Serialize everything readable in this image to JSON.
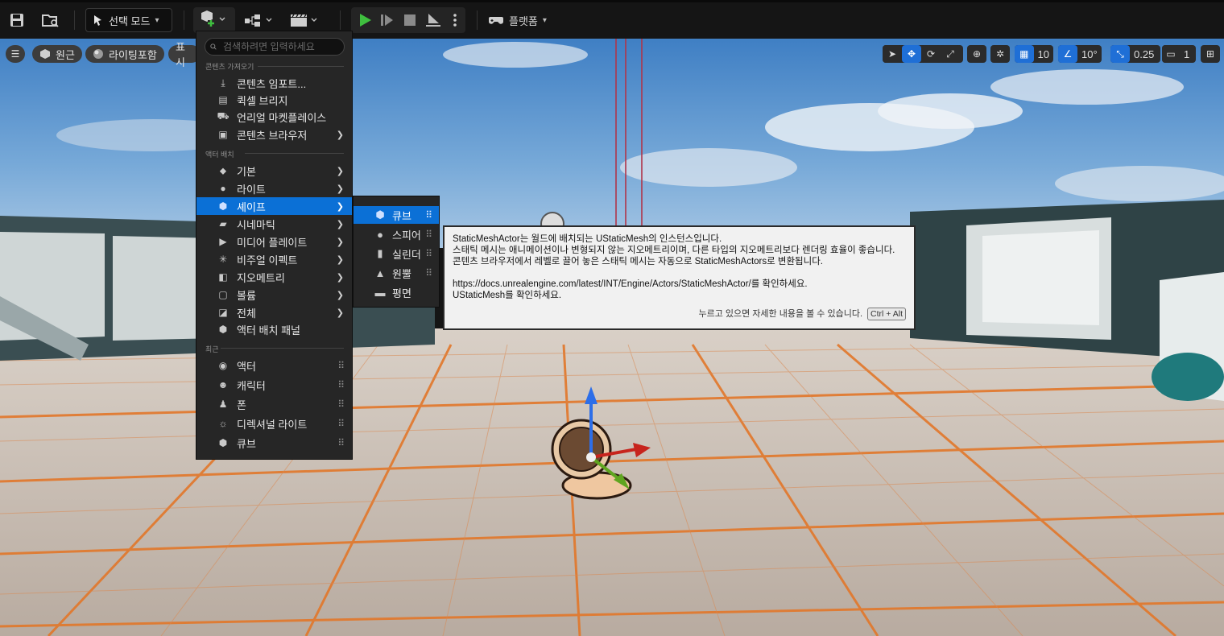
{
  "toolbar": {
    "mode_label": "선택 모드",
    "platform_label": "플랫폼"
  },
  "viewport": {
    "view_label": "원근",
    "lighting_label": "라이팅포함",
    "show_label": "표시",
    "grid_snap_value": "10",
    "rotation_snap_value": "10°",
    "scale_snap_value": "0.25",
    "camera_speed_value": "1"
  },
  "menu": {
    "search_placeholder": "검색하려면 입력하세요",
    "sections": {
      "import": "콘텐츠 가져오기",
      "placement": "액터 배치",
      "recent": "최근"
    },
    "import_items": [
      {
        "label": "콘텐츠 임포트..."
      },
      {
        "label": "퀵셀 브리지"
      },
      {
        "label": "언리얼 마켓플레이스"
      },
      {
        "label": "콘텐츠 브라우저"
      }
    ],
    "placement_items": [
      {
        "label": "기본"
      },
      {
        "label": "라이트"
      },
      {
        "label": "셰이프"
      },
      {
        "label": "시네마틱"
      },
      {
        "label": "미디어 플레이트"
      },
      {
        "label": "비주얼 이펙트"
      },
      {
        "label": "지오메트리"
      },
      {
        "label": "볼륨"
      },
      {
        "label": "전체"
      },
      {
        "label": "액터 배치 패널"
      }
    ],
    "recent_items": [
      {
        "label": "액터"
      },
      {
        "label": "캐릭터"
      },
      {
        "label": "폰"
      },
      {
        "label": "디렉셔널 라이트"
      },
      {
        "label": "큐브"
      }
    ]
  },
  "submenu": {
    "items": [
      {
        "label": "큐브"
      },
      {
        "label": "스피어"
      },
      {
        "label": "실린더"
      },
      {
        "label": "원뿔"
      },
      {
        "label": "평면"
      }
    ]
  },
  "tooltip": {
    "line1": "StaticMeshActor는 월드에 배치되는 UStaticMesh의 인스턴스입니다.",
    "line2": "스태틱 메시는 애니메이션이나 변형되지 않는 지오메트리이며, 다른 타입의 지오메트리보다 렌더링 효율이 좋습니다.",
    "line3": "콘텐츠 브라우저에서 레벨로 끌어 놓은 스태틱 메시는 자동으로 StaticMeshActors로 변환됩니다.",
    "line4": "https://docs.unrealengine.com/latest/INT/Engine/Actors/StaticMeshActor/를 확인하세요.",
    "line5": "UStaticMesh를 확인하세요.",
    "footer_hint": "누르고 있으면 자세한 내용을 볼 수 있습니다.",
    "footer_shortcut": "Ctrl + Alt"
  },
  "colors": {
    "accent": "#0b70d6",
    "play": "#3fbf3f",
    "grid_line": "#e2772a"
  }
}
